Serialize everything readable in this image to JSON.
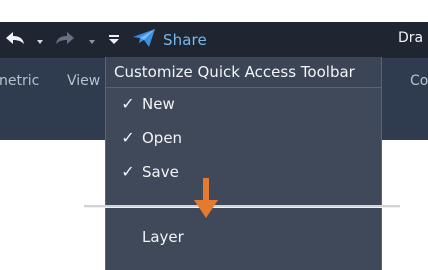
{
  "window": {
    "title_partial": "Dra"
  },
  "quick_access_toolbar": {
    "share_label": "Share",
    "icons": [
      "undo-icon",
      "chevron-down-icon",
      "redo-icon",
      "chevron-down-icon",
      "customize-qat-icon",
      "share-icon"
    ]
  },
  "ribbon": {
    "tabs": [
      "netric",
      "View",
      "Co"
    ]
  },
  "menu": {
    "header": "Customize Quick Access Toolbar",
    "items": [
      {
        "label": "New",
        "checked": true
      },
      {
        "label": "Open",
        "checked": true
      },
      {
        "label": "Save",
        "checked": true
      },
      {
        "label": "Layer",
        "checked": false
      }
    ]
  },
  "colors": {
    "title_bar": "#1f2632",
    "ribbon": "#2f3c4f",
    "menu": "#3f4959",
    "accent_blue": "#79b7ef",
    "arrow_orange": "#e27a2f"
  }
}
